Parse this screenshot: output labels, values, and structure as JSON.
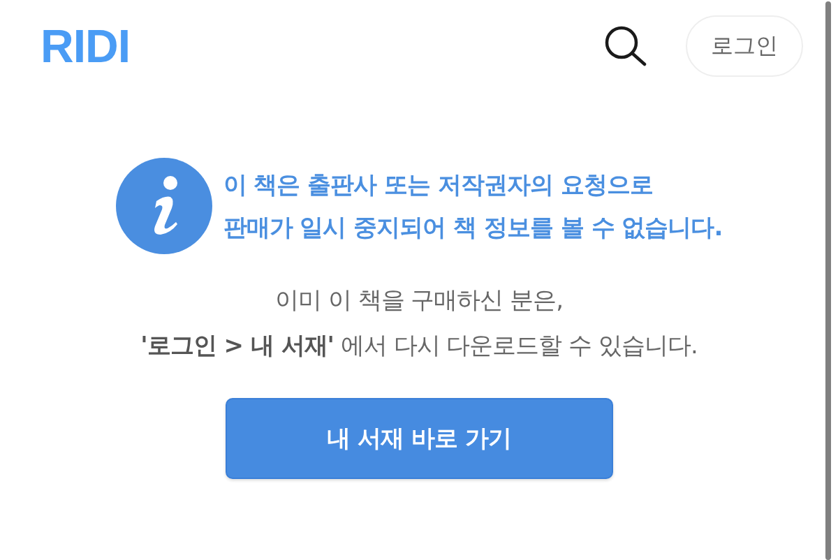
{
  "header": {
    "logo": "RIDI",
    "login_button": "로그인"
  },
  "notice": {
    "message_lines": [
      "이 책은 출판사 또는 저작권자의 요청으로",
      "판매가 일시 중지되어 책 정보를 볼 수 없습니다."
    ]
  },
  "help_text": {
    "lines": [
      "이미 이 책을 구매하신 분은,",
      "**'로그인 > 내 서재'** 에서 다시 다운로드할 수 있습니다."
    ]
  },
  "library_button": "내 서재 바로 가기"
}
